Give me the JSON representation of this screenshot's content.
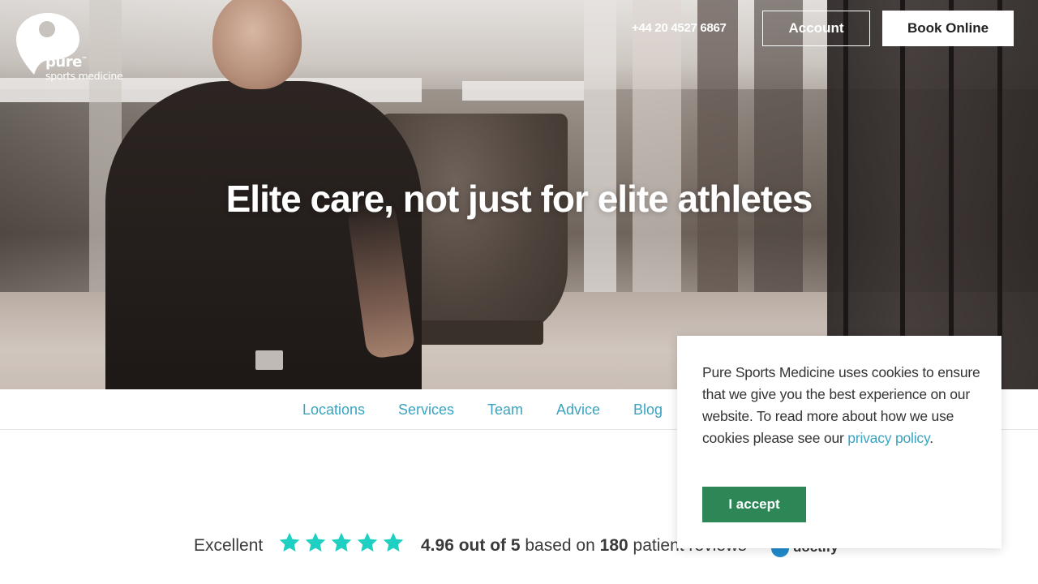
{
  "header": {
    "logo_word": "pure",
    "logo_tm": "™",
    "logo_sub": "sports medicine",
    "phone": "+44 20 4527 6867",
    "account_label": "Account",
    "book_label": "Book Online"
  },
  "hero": {
    "title": "Elite care, not just for elite athletes"
  },
  "nav": {
    "items": [
      {
        "label": "Locations"
      },
      {
        "label": "Services"
      },
      {
        "label": "Team"
      },
      {
        "label": "Advice"
      },
      {
        "label": "Blog"
      }
    ]
  },
  "reviews": {
    "rating_word": "Excellent",
    "star_count": 5,
    "star_color": "#1fcfc1",
    "score": "4.96 out of 5",
    "based_on": "based on",
    "count": "180",
    "suffix": "patient reviews",
    "provider": "doctify"
  },
  "cookie": {
    "text_before": "Pure Sports Medicine uses cookies to ensure that we give you the best experience on our website. To read more about how we use cookies please see our",
    "link_text": "privacy policy",
    "text_after": ".",
    "accept_label": "I accept"
  },
  "colors": {
    "accent_link": "#3aa3c0",
    "accept_button": "#2c8656"
  }
}
